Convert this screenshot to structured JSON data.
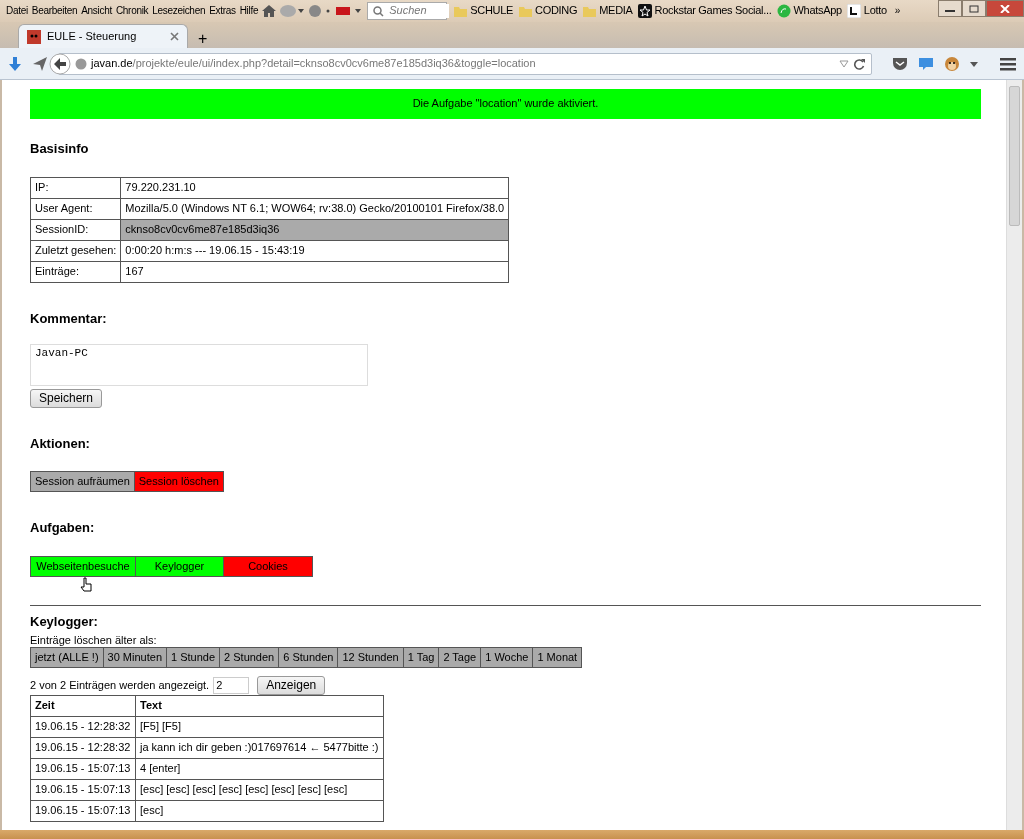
{
  "browser": {
    "menu": [
      "Datei",
      "Bearbeiten",
      "Ansicht",
      "Chronik",
      "Lesezeichen",
      "Extras",
      "Hilfe"
    ],
    "search": {
      "placeholder": "Suchen"
    },
    "bookmarks": [
      {
        "label": "SCHULE",
        "kind": "folder"
      },
      {
        "label": "CODING",
        "kind": "folder"
      },
      {
        "label": "MEDIA",
        "kind": "folder"
      },
      {
        "label": "Rockstar Games Social...",
        "kind": "star"
      },
      {
        "label": "WhatsApp",
        "kind": "chat"
      },
      {
        "label": "Lotto",
        "kind": "letter"
      }
    ],
    "overflow": "»",
    "tabs": [
      {
        "title": "EULE - Steuerung",
        "selected": true
      }
    ],
    "new_tab": "+",
    "url": {
      "host": "javan.de",
      "path": "/projekte/eule/ui/index.php?detail=cknso8cv0cv6me87e185d3iq36&toggle=location"
    }
  },
  "page": {
    "notice": "Die Aufgabe \"location\" wurde aktiviert.",
    "basisinfo": {
      "heading": "Basisinfo",
      "rows": [
        {
          "label": "IP:",
          "value": "79.220.231.10",
          "highlighted": false
        },
        {
          "label": "User Agent:",
          "value": "Mozilla/5.0 (Windows NT 6.1; WOW64; rv:38.0) Gecko/20100101 Firefox/38.0",
          "highlighted": false
        },
        {
          "label": "SessionID:",
          "value": "cknso8cv0cv6me87e185d3iq36",
          "highlighted": true
        },
        {
          "label": "Zuletzt gesehen:",
          "value": "0:00:20 h:m:s --- 19.06.15 - 15:43:19",
          "highlighted": false
        },
        {
          "label": "Einträge:",
          "value": "167",
          "highlighted": false
        }
      ]
    },
    "kommentar": {
      "heading": "Kommentar:",
      "value": "Javan-PC",
      "button": "Speichern"
    },
    "aktionen": {
      "heading": "Aktionen:",
      "buttons": [
        {
          "label": "Session aufräumen",
          "color": "#aaaaaa"
        },
        {
          "label": "Session löschen",
          "color": "#ff0000"
        }
      ]
    },
    "aufgaben": {
      "heading": "Aufgaben:",
      "tasks": [
        {
          "label": "Webseitenbesuche",
          "on": true
        },
        {
          "label": "Keylogger",
          "on": true
        },
        {
          "label": "Cookies",
          "on": false
        }
      ]
    },
    "keylogger": {
      "heading": "Keylogger:",
      "delete_label": "Einträge löschen älter als:",
      "delete_buttons": [
        "jetzt (ALLE !)",
        "30 Minuten",
        "1 Stunde",
        "2 Stunden",
        "6 Stunden",
        "12 Stunden",
        "1 Tag",
        "2 Tage",
        "1 Woche",
        "1 Monat"
      ],
      "count_text": "2 von 2 Einträgen werden angezeigt.",
      "count_value": "2",
      "show_button": "Anzeigen",
      "columns": [
        "Zeit",
        "Text"
      ],
      "rows": [
        [
          "19.06.15 - 12:28:32",
          "[F5] [F5]"
        ],
        [
          "19.06.15 - 12:28:32",
          "ja kann ich dir geben :)017697614 ← 5477bitte :)"
        ],
        [
          "19.06.15 - 15:07:13",
          "4 [enter]"
        ],
        [
          "19.06.15 - 15:07:13",
          "[esc] [esc] [esc] [esc] [esc] [esc] [esc] [esc]"
        ],
        [
          "19.06.15 - 15:07:13",
          "[esc]"
        ]
      ]
    }
  }
}
